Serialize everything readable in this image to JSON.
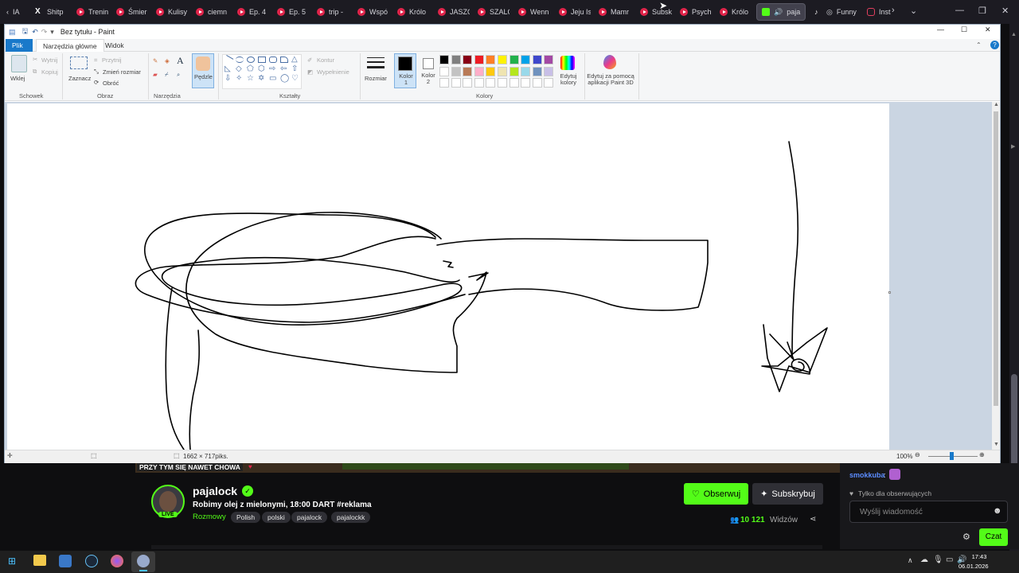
{
  "browser": {
    "tabs": [
      {
        "label": "IA"
      },
      {
        "label": "Shitp"
      },
      {
        "label": "Trenin"
      },
      {
        "label": "Śmier"
      },
      {
        "label": "Kulisy"
      },
      {
        "label": "ciemn"
      },
      {
        "label": "Ep. 4"
      },
      {
        "label": "Ep. 5"
      },
      {
        "label": "trip -"
      },
      {
        "label": "Wspó"
      },
      {
        "label": "Królo"
      },
      {
        "label": "JASZC"
      },
      {
        "label": "SZALC"
      },
      {
        "label": "Wenn"
      },
      {
        "label": "Jeju Is"
      },
      {
        "label": "Mamr"
      },
      {
        "label": "Subsk"
      },
      {
        "label": "Psych"
      },
      {
        "label": "Królo"
      },
      {
        "label": "paja"
      },
      {
        "label": "Funny"
      },
      {
        "label": "Insta"
      }
    ]
  },
  "paint": {
    "title": "Bez tytułu - Paint",
    "menu": {
      "file": "Plik",
      "home": "Narzędzia główne",
      "view": "Widok"
    },
    "ribbon": {
      "paste": "Wklej",
      "cut": "Wytnij",
      "copy": "Kopiuj",
      "select": "Zaznacz",
      "crop": "Przytnij",
      "resize": "Zmień rozmiar",
      "rotate": "Obróć",
      "brushes": "Pędzle",
      "outline": "Kontur",
      "fill": "Wypełnienie",
      "size": "Rozmiar",
      "color1": "Kolor 1",
      "color2": "Kolor 2",
      "edit_colors": "Edytuj kolory",
      "paint3d": "Edytuj za pomocą aplikacji Paint 3D",
      "groups": {
        "clipboard": "Schowek",
        "image": "Obraz",
        "tools": "Narzędzia",
        "shapes": "Kształty",
        "colors": "Kolory"
      }
    },
    "palette": [
      "#000000",
      "#7f7f7f",
      "#880015",
      "#ed1c24",
      "#ff7f27",
      "#fff200",
      "#22b14c",
      "#00a2e8",
      "#3f48cc",
      "#a349a4",
      "#ffffff",
      "#c3c3c3",
      "#b97a57",
      "#ffaec9",
      "#ffc90e",
      "#efe4b0",
      "#b5e61d",
      "#99d9ea",
      "#7092be",
      "#c8bfe7"
    ],
    "status": {
      "dimensions": "1662 × 717piks.",
      "zoom": "100%"
    }
  },
  "stream": {
    "banner": "PRZY TYM SIĘ NAWET CHOWA",
    "channel": "pajalock",
    "title": "Robimy olej z mielonymi, 18:00 DART #reklama",
    "category": "Rozmowy",
    "tags": [
      "Polish",
      "polski",
      "pajalock",
      "pajalockk"
    ],
    "follow": "Obserwuj",
    "subscribe": "Subskrybuj",
    "viewers": "10 121",
    "viewers_label": "Widzów",
    "live": "LIVE"
  },
  "chat": {
    "user": "smokkuba",
    "followers_only": "Tylko dla obserwujących",
    "placeholder": "Wyślij wiadomość",
    "send": "Czat"
  },
  "taskbar": {
    "time": "17:43",
    "date": "06.01.2026"
  }
}
